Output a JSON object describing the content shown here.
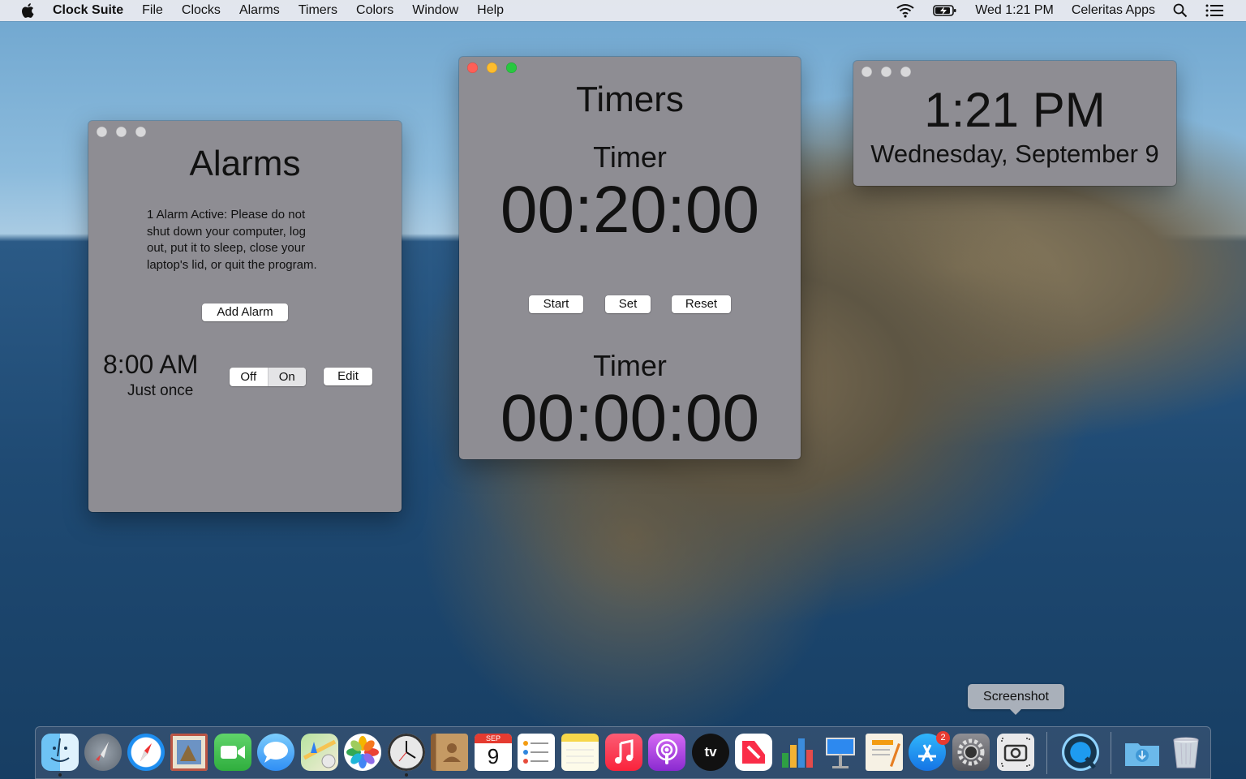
{
  "menubar": {
    "app_name": "Clock Suite",
    "menus": [
      "File",
      "Clocks",
      "Alarms",
      "Timers",
      "Colors",
      "Window",
      "Help"
    ],
    "datetime": "Wed 1:21 PM",
    "user": "Celeritas Apps"
  },
  "alarms_window": {
    "title": "Alarms",
    "notice_lines": [
      "1 Alarm Active: Please do not",
      "shut down your computer, log",
      "out, put it to sleep, close your",
      "laptop's lid, or quit the program."
    ],
    "add_button": "Add Alarm",
    "alarm": {
      "time": "8:00 AM",
      "repeat": "Just once",
      "toggle_off": "Off",
      "toggle_on": "On",
      "selected": "On",
      "edit_button": "Edit"
    }
  },
  "timers_window": {
    "title": "Timers",
    "timers": [
      {
        "label": "Timer",
        "value": "00:20:00"
      },
      {
        "label": "Timer",
        "value": "00:00:00"
      }
    ],
    "buttons": {
      "start": "Start",
      "set": "Set",
      "reset": "Reset"
    }
  },
  "clock_window": {
    "time": "1:21 PM",
    "date": "Wednesday, September 9"
  },
  "dock": {
    "tooltip": "Screenshot",
    "calendar_month": "SEP",
    "calendar_day": "9",
    "appstore_badge": "2",
    "tv_label": "tv",
    "icons": [
      "finder-icon",
      "launchpad-icon",
      "safari-icon",
      "mail-icon",
      "facetime-icon",
      "messages-icon",
      "maps-icon",
      "photos-icon",
      "clock-suite-icon",
      "contacts-icon",
      "calendar-icon",
      "reminders-icon",
      "notes-icon",
      "music-icon",
      "podcasts-icon",
      "apple-tv-icon",
      "news-icon",
      "numbers-icon",
      "keynote-icon",
      "pages-icon",
      "app-store-icon",
      "system-preferences-icon",
      "screenshot-icon",
      "quicktime-icon",
      "downloads-folder-icon",
      "trash-icon"
    ]
  }
}
